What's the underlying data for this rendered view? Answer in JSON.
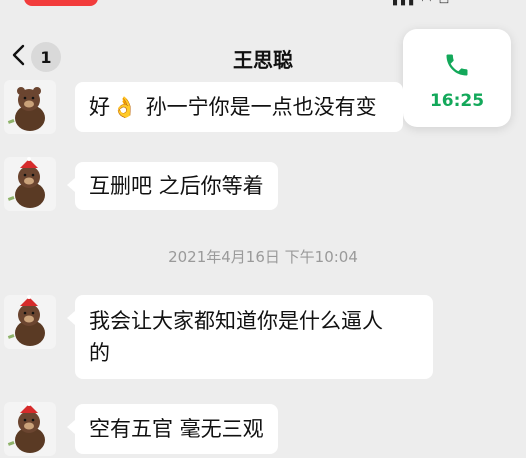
{
  "header": {
    "title": "王思聪",
    "unread_count": "1"
  },
  "call_card": {
    "time": "16:25",
    "accent": "#13a85a"
  },
  "messages": [
    {
      "text_before": "好",
      "emoji": "👌",
      "text_after": " 孙一宁你是一点也没有变"
    },
    {
      "text": "互删吧 之后你等着"
    },
    {
      "text_line1": "我会让大家都知道你是什么逼人",
      "text_line2": "的"
    },
    {
      "text": "空有五官 毫无三观"
    }
  ],
  "timestamp": "2021年4月16日 下午10:04"
}
